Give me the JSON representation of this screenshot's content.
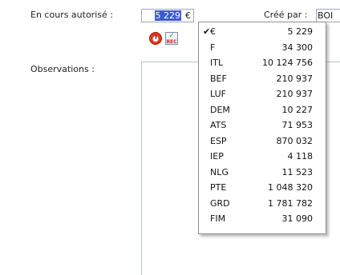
{
  "form": {
    "authorized_label": "En cours autorisé :",
    "amount_value": "5 229",
    "amount_currency": "€",
    "created_by_label": "Créé par :",
    "created_by_value": "BOI",
    "observations_label": "Observations :"
  },
  "toolbar": {
    "clock_icon": "clock-icon",
    "calculator_icon": "calculator-icon",
    "calculator_glyph": "REC"
  },
  "currency_menu": {
    "checked_symbol": "✔",
    "items": [
      {
        "code": "€",
        "value": "5 229",
        "checked": true
      },
      {
        "code": "F",
        "value": "34 300"
      },
      {
        "code": "ITL",
        "value": "10 124 756"
      },
      {
        "code": "BEF",
        "value": "210 937"
      },
      {
        "code": "LUF",
        "value": "210 937"
      },
      {
        "code": "DEM",
        "value": "10 227"
      },
      {
        "code": "ATS",
        "value": "71 953"
      },
      {
        "code": "ESP",
        "value": "870 032"
      },
      {
        "code": "IEP",
        "value": "4 118"
      },
      {
        "code": "NLG",
        "value": "11 523"
      },
      {
        "code": "PTE",
        "value": "1 048 320"
      },
      {
        "code": "GRD",
        "value": "1 781 782"
      },
      {
        "code": "FIM",
        "value": "31 090"
      }
    ]
  },
  "colors": {
    "selection": "#3d5bd1",
    "field_border": "#9aa7b8",
    "menu_border": "#8e8e8e"
  }
}
